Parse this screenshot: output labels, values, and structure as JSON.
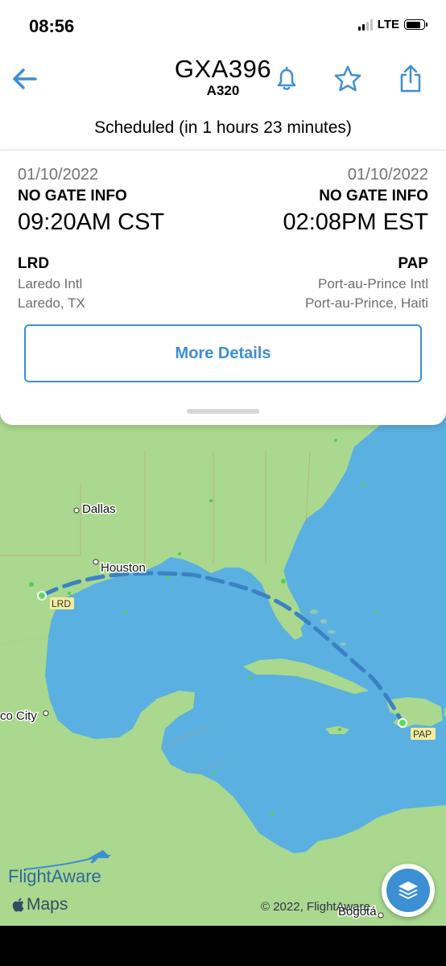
{
  "status_bar": {
    "time": "08:56",
    "network": "LTE"
  },
  "header": {
    "flight": "GXA396",
    "aircraft": "A320"
  },
  "flight_status": "Scheduled (in 1 hours 23 minutes)",
  "departure": {
    "date": "01/10/2022",
    "gate": "NO GATE INFO",
    "time": "09:20AM CST",
    "code": "LRD",
    "airport": "Laredo Intl",
    "city": "Laredo, TX"
  },
  "arrival": {
    "date": "01/10/2022",
    "gate": "NO GATE INFO",
    "time": "02:08PM EST",
    "code": "PAP",
    "airport": "Port-au-Prince Intl",
    "city": "Port-au-Prince, Haiti"
  },
  "more_details_label": "More Details",
  "map": {
    "labels": {
      "dallas": "Dallas",
      "houston": "Houston",
      "mexico_city": "co City",
      "bogota": "Bogotá",
      "lrd": "LRD",
      "pap": "PAP"
    },
    "brand": "FlightAware",
    "maps": "Maps",
    "copyright": "© 2022, FlightAware"
  },
  "icons": {
    "back": "arrow-left-icon",
    "bell": "bell-icon",
    "star": "star-icon",
    "share": "share-icon",
    "layers": "layers-icon"
  },
  "colors": {
    "accent": "#3d8fd4",
    "water": "#5ab0e0",
    "land": "#a9d88e"
  }
}
